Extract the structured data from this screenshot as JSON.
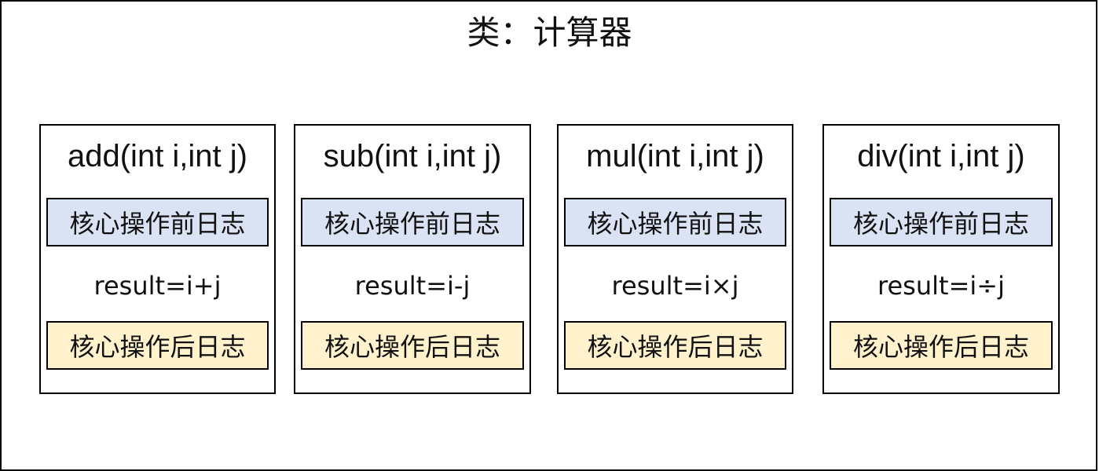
{
  "title": "类：计算器",
  "methods": [
    {
      "signature": "add(int i,int j)",
      "before_log": "核心操作前日志",
      "result": "result=i+j",
      "after_log": "核心操作后日志"
    },
    {
      "signature": "sub(int i,int j)",
      "before_log": "核心操作前日志",
      "result": "result=i-j",
      "after_log": "核心操作后日志"
    },
    {
      "signature": "mul(int i,int j)",
      "before_log": "核心操作前日志",
      "result": "result=i×j",
      "after_log": "核心操作后日志"
    },
    {
      "signature": "div(int i,int j)",
      "before_log": "核心操作前日志",
      "result": "result=i÷j",
      "after_log": "核心操作后日志"
    }
  ],
  "colors": {
    "before_log_fill": "#dae3f3",
    "after_log_fill": "#fff2cc",
    "border": "#000000"
  }
}
